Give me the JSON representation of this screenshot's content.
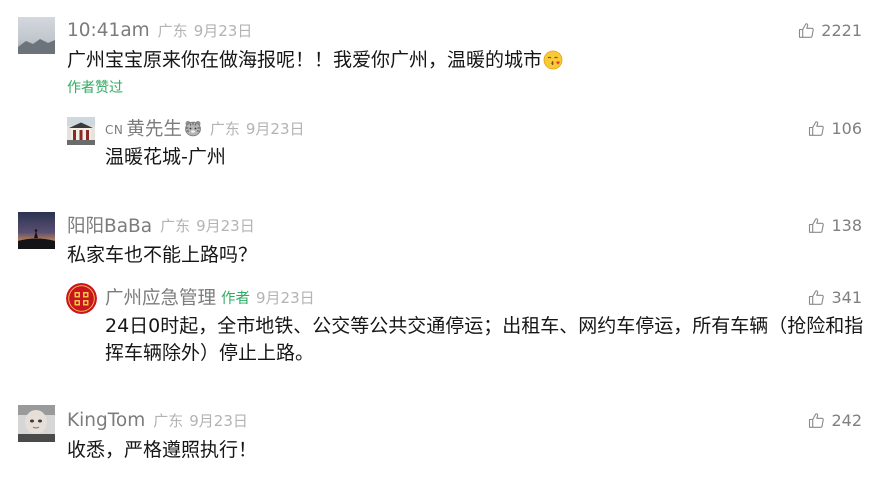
{
  "comments": [
    {
      "avatar": "landscape-photo-avatar",
      "author": "10:41am",
      "location": "广东",
      "date": "9月23日",
      "likes": "2221",
      "text": "广州宝宝原来你在做海报呢！！我爱你广州，温暖的城市",
      "text_emoji_icon": "kissing-face-emoji",
      "author_liked": "作者赞过",
      "reply": {
        "avatar": "building-photo-avatar",
        "author_prefix": "CN",
        "author": "黄先生",
        "author_emoji_icon": "tiger-face-emoji",
        "location": "广东",
        "date": "9月23日",
        "likes": "106",
        "text": "温暖花城-广州"
      }
    },
    {
      "avatar": "night-sky-photo-avatar",
      "author": "阳阳BaBa",
      "location": "广东",
      "date": "9月23日",
      "likes": "138",
      "text": "私家车也不能上路吗？",
      "reply": {
        "avatar": "red-emblem-logo-avatar",
        "author": "广州应急管理",
        "author_badge": "作者",
        "date": "9月23日",
        "likes": "341",
        "text_lines": [
          "24日0时起，全市地铁、公交等公共交通停运；出租车、网约车停运，所有车辆（抢险和指",
          "挥车辆除外）停止上路。"
        ]
      }
    },
    {
      "avatar": "baby-photo-avatar",
      "author": "KingTom",
      "location": "广东",
      "date": "9月23日",
      "likes": "242",
      "text": "收悉，严格遵照执行！"
    }
  ],
  "icons": {
    "like": "thumbs-up-icon"
  },
  "colors": {
    "name": "#7c7c7c",
    "meta": "#b3b3b3",
    "text": "#161616",
    "author_green": "#2fac62",
    "like": "#808080"
  }
}
